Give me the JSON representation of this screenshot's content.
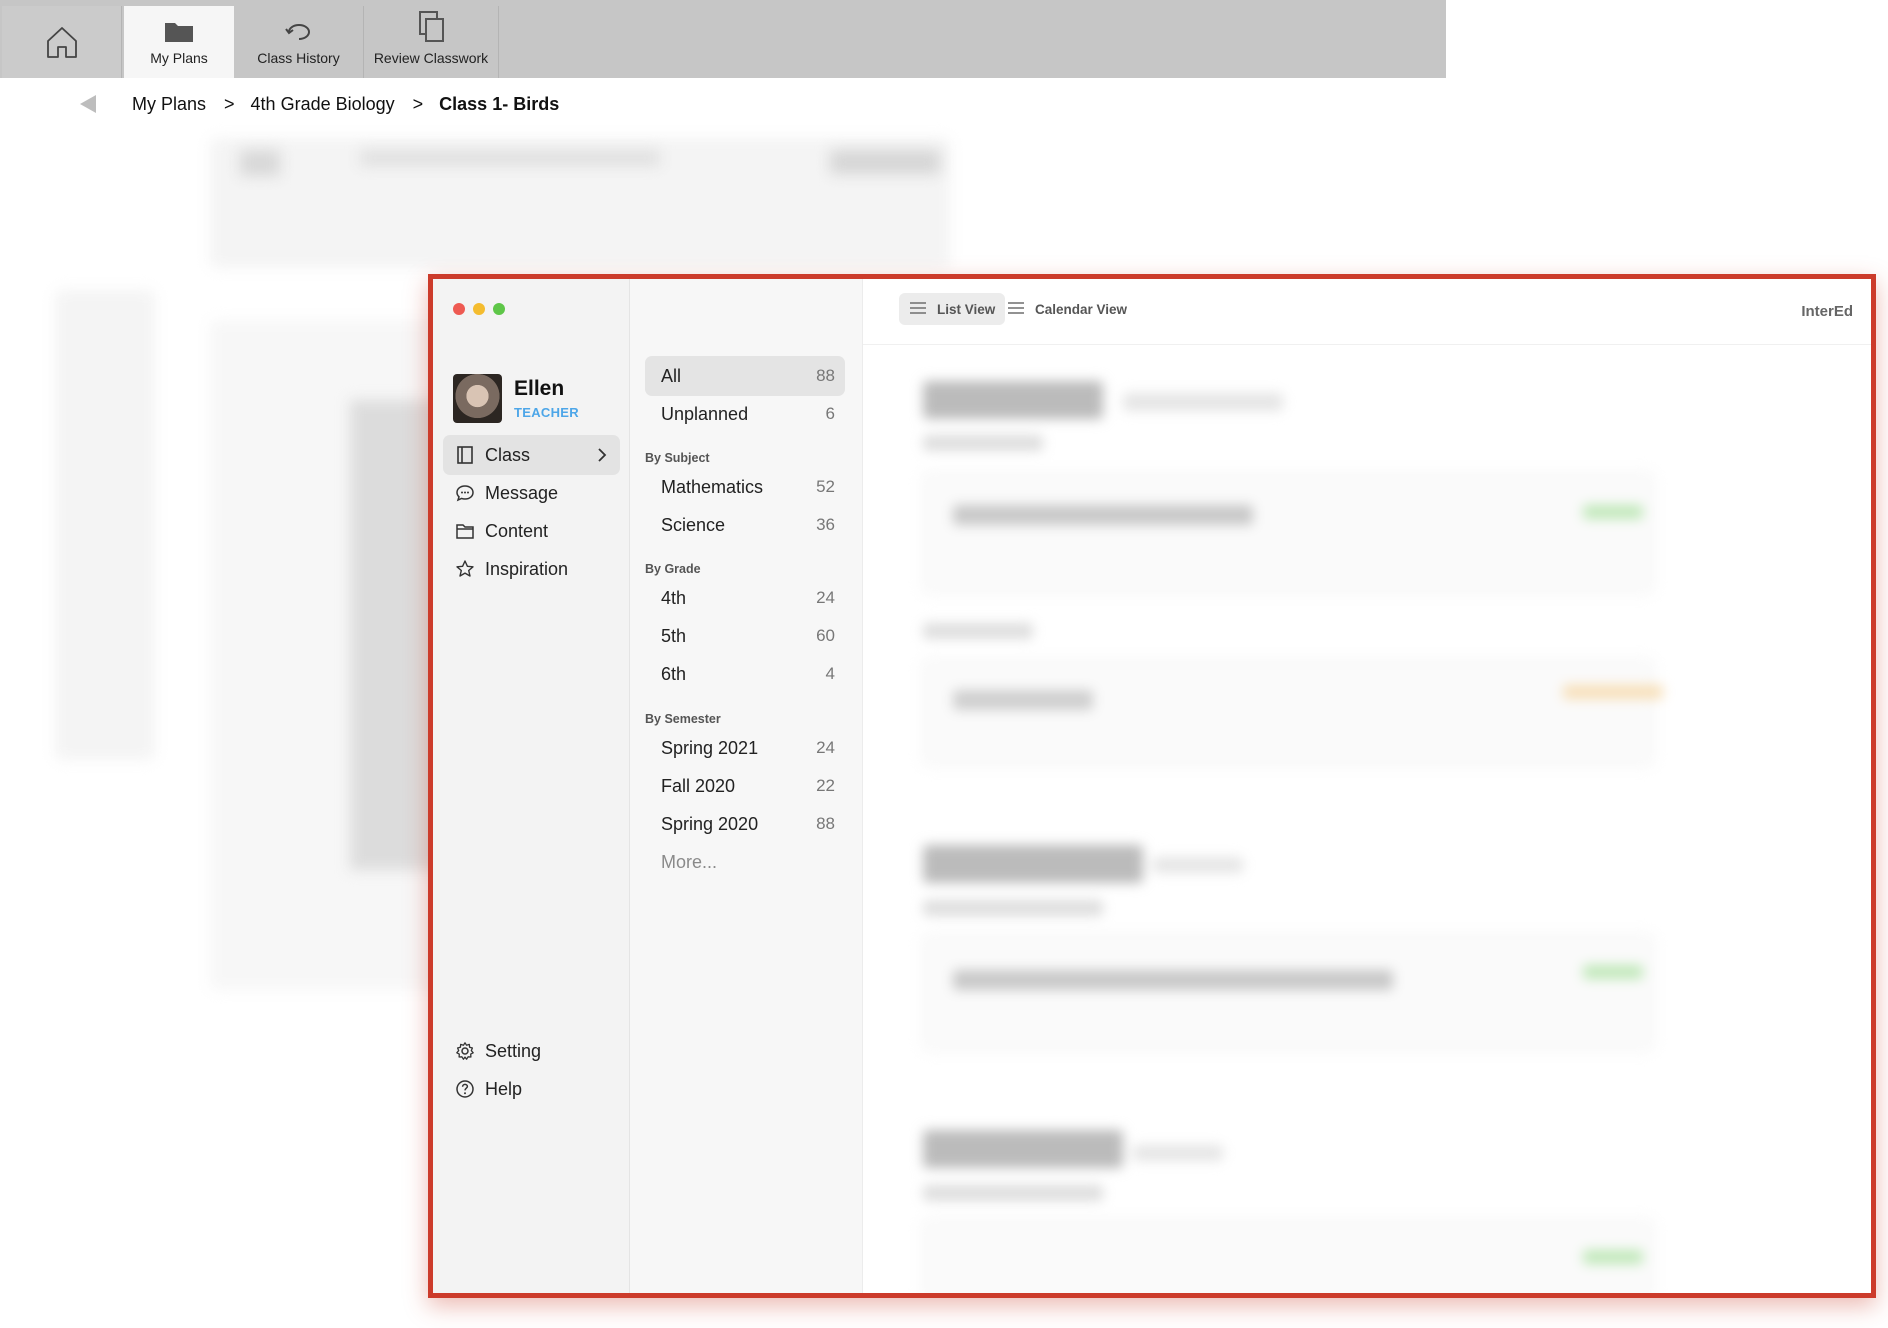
{
  "topbar": {
    "tabs": [
      {
        "label": "",
        "icon": "home-icon"
      },
      {
        "label": "My Plans",
        "icon": "folder-icon"
      },
      {
        "label": "Class History",
        "icon": "history-icon"
      },
      {
        "label": "Review Classwork",
        "icon": "copy-icon"
      }
    ]
  },
  "breadcrumb": {
    "items": [
      "My Plans",
      "4th Grade Biology",
      "Class 1- Birds"
    ],
    "separator": ">"
  },
  "app": {
    "user": {
      "name": "Ellen",
      "role": "TEACHER"
    },
    "nav": [
      {
        "label": "Class",
        "icon": "notebook-icon"
      },
      {
        "label": "Message",
        "icon": "chat-bubble-icon"
      },
      {
        "label": "Content",
        "icon": "folder-icon"
      },
      {
        "label": "Inspiration",
        "icon": "star-icon"
      }
    ],
    "footer_nav": [
      {
        "label": "Setting",
        "icon": "gear-icon"
      },
      {
        "label": "Help",
        "icon": "question-icon"
      }
    ],
    "filters": {
      "top": [
        {
          "label": "All",
          "count": "88"
        },
        {
          "label": "Unplanned",
          "count": "6"
        }
      ],
      "by_subject": {
        "heading": "By Subject",
        "items": [
          {
            "label": "Mathematics",
            "count": "52"
          },
          {
            "label": "Science",
            "count": "36"
          }
        ]
      },
      "by_grade": {
        "heading": "By Grade",
        "items": [
          {
            "label": "4th",
            "count": "24"
          },
          {
            "label": "5th",
            "count": "60"
          },
          {
            "label": "6th",
            "count": "4"
          }
        ]
      },
      "by_semester": {
        "heading": "By Semester",
        "items": [
          {
            "label": "Spring 2021",
            "count": "24"
          },
          {
            "label": "Fall 2020",
            "count": "22"
          },
          {
            "label": "Spring 2020",
            "count": "88"
          }
        ]
      },
      "more": "More..."
    },
    "toolbar": {
      "list_view": "List View",
      "calendar_view": "Calendar View",
      "brand": "InterEd"
    }
  },
  "colors": {
    "frame_border": "#cc3b2b",
    "role_blue": "#4da6e8",
    "traffic_red": "#ee5a52",
    "traffic_yellow": "#f4bc2f",
    "traffic_green": "#5ec648"
  }
}
